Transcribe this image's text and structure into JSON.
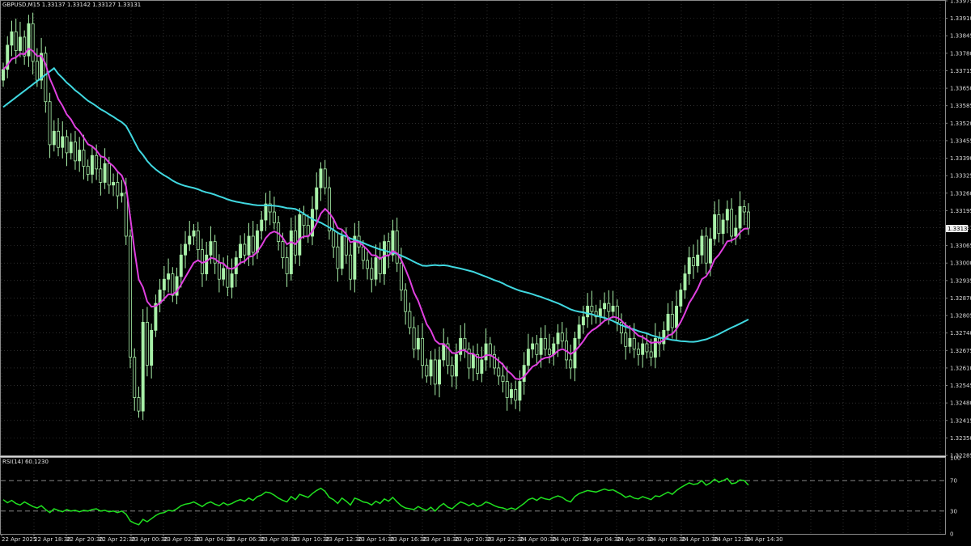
{
  "header": {
    "symbol_info": "GBPUSD,M15  1.33137 1.33142 1.33127 1.33131",
    "rsi_label": "RSI(14) 60.1230"
  },
  "price_tag": "1.33131",
  "colors": {
    "background": "#000000",
    "grid": "#4a4a4a",
    "candle_up": "#a8f0a8",
    "candle_down": "#000000",
    "candle_outline": "#a8f0a8",
    "ma_fast": "#e040e0",
    "ma_slow": "#40d8e0",
    "rsi_line": "#20e020",
    "axis_text": "#dcdcdc",
    "rsi_level_line": "#9a9a9a"
  },
  "chart_data": [
    {
      "type": "candlestick",
      "title": "GBPUSD,M15",
      "ohlc_readout": {
        "open": 1.33137,
        "high": 1.33142,
        "low": 1.33127,
        "close": 1.33131
      },
      "y_ticks": [
        "1.33975",
        "1.33910",
        "1.33845",
        "1.33780",
        "1.33715",
        "1.33650",
        "1.33585",
        "1.33520",
        "1.33455",
        "1.33390",
        "1.33325",
        "1.33260",
        "1.33195",
        "1.33131",
        "1.33065",
        "1.33000",
        "1.32935",
        "1.32870",
        "1.32805",
        "1.32740",
        "1.32675",
        "1.32610",
        "1.32545",
        "1.32480",
        "1.32415",
        "1.32350",
        "1.32285"
      ],
      "ylim": [
        1.32285,
        1.33975
      ],
      "x_ticks": [
        "22 Apr 2025",
        "22 Apr 18:30",
        "22 Apr 20:30",
        "22 Apr 22:30",
        "23 Apr 00:30",
        "23 Apr 02:30",
        "23 Apr 04:30",
        "23 Apr 06:30",
        "23 Apr 08:30",
        "23 Apr 10:30",
        "23 Apr 12:30",
        "23 Apr 14:30",
        "23 Apr 16:30",
        "23 Apr 18:30",
        "23 Apr 20:30",
        "23 Apr 22:30",
        "24 Apr 00:30",
        "24 Apr 02:30",
        "24 Apr 04:30",
        "24 Apr 06:30",
        "24 Apr 08:30",
        "24 Apr 10:30",
        "24 Apr 12:30",
        "24 Apr 14:30"
      ],
      "close_series": [
        1.3372,
        1.3381,
        1.3386,
        1.3379,
        1.3384,
        1.3377,
        1.3389,
        1.3375,
        1.3368,
        1.3378,
        1.336,
        1.3344,
        1.3349,
        1.3343,
        1.3347,
        1.3341,
        1.3345,
        1.3338,
        1.3342,
        1.3336,
        1.3333,
        1.334,
        1.3335,
        1.333,
        1.3337,
        1.3329,
        1.333,
        1.3325,
        1.3326,
        1.331,
        1.3265,
        1.325,
        1.3245,
        1.3278,
        1.3262,
        1.3275,
        1.3285,
        1.329,
        1.3294,
        1.3296,
        1.3288,
        1.3295,
        1.3303,
        1.3307,
        1.331,
        1.3312,
        1.3305,
        1.3296,
        1.3303,
        1.3308,
        1.33,
        1.3294,
        1.3298,
        1.3291,
        1.3296,
        1.3302,
        1.3307,
        1.3303,
        1.331,
        1.3304,
        1.3312,
        1.3316,
        1.3322,
        1.3319,
        1.3315,
        1.3308,
        1.3302,
        1.3296,
        1.3312,
        1.3303,
        1.3318,
        1.3314,
        1.331,
        1.332,
        1.3328,
        1.3335,
        1.3328,
        1.3312,
        1.3306,
        1.3298,
        1.331,
        1.3303,
        1.3294,
        1.331,
        1.3306,
        1.3301,
        1.3298,
        1.3294,
        1.3302,
        1.3296,
        1.3308,
        1.3303,
        1.3312,
        1.33,
        1.329,
        1.3282,
        1.3276,
        1.3268,
        1.3272,
        1.3262,
        1.3258,
        1.3264,
        1.3255,
        1.3264,
        1.327,
        1.3262,
        1.3258,
        1.3266,
        1.3272,
        1.3268,
        1.3261,
        1.3266,
        1.3259,
        1.3264,
        1.327,
        1.3266,
        1.3261,
        1.3258,
        1.3256,
        1.325,
        1.3253,
        1.3249,
        1.3256,
        1.3262,
        1.3268,
        1.327,
        1.3266,
        1.3272,
        1.3268,
        1.3266,
        1.327,
        1.3274,
        1.3271,
        1.3264,
        1.3261,
        1.3272,
        1.3277,
        1.328,
        1.3284,
        1.3282,
        1.328,
        1.3283,
        1.3285,
        1.3282,
        1.3284,
        1.3278,
        1.3274,
        1.3269,
        1.3272,
        1.3268,
        1.3266,
        1.327,
        1.3267,
        1.3265,
        1.3272,
        1.327,
        1.3275,
        1.3281,
        1.3276,
        1.3284,
        1.329,
        1.3296,
        1.3302,
        1.3299,
        1.3303,
        1.331,
        1.33,
        1.3309,
        1.3318,
        1.3311,
        1.3316,
        1.332,
        1.331,
        1.3313,
        1.3321,
        1.3319,
        1.3313
      ],
      "indicators": [
        {
          "name": "MA fast",
          "color": "#e040e0"
        },
        {
          "name": "MA slow",
          "color": "#40d8e0"
        }
      ]
    },
    {
      "type": "line",
      "title": "RSI(14) 60.1230",
      "y_ticks": [
        "100",
        "70",
        "30",
        "0"
      ],
      "ylim": [
        0,
        100
      ],
      "levels": [
        70,
        30
      ],
      "series": [
        {
          "values": [
            45,
            41,
            44,
            40,
            38,
            42,
            39,
            36,
            34,
            37,
            32,
            28,
            33,
            31,
            29,
            32,
            30,
            31,
            29,
            31,
            30,
            32,
            33,
            30,
            31,
            29,
            30,
            28,
            30,
            26,
            17,
            14,
            12,
            19,
            16,
            20,
            24,
            27,
            28,
            31,
            30,
            33,
            37,
            39,
            40,
            42,
            39,
            36,
            40,
            42,
            39,
            37,
            41,
            38,
            40,
            43,
            45,
            43,
            47,
            44,
            49,
            51,
            55,
            54,
            51,
            47,
            44,
            42,
            49,
            45,
            52,
            50,
            48,
            53,
            57,
            60,
            56,
            48,
            45,
            40,
            47,
            43,
            38,
            47,
            45,
            42,
            41,
            38,
            43,
            40,
            46,
            43,
            48,
            42,
            37,
            34,
            33,
            32,
            36,
            33,
            31,
            35,
            30,
            36,
            40,
            35,
            33,
            38,
            42,
            40,
            37,
            40,
            36,
            38,
            42,
            40,
            37,
            35,
            34,
            32,
            34,
            32,
            36,
            40,
            45,
            47,
            44,
            48,
            46,
            45,
            48,
            50,
            48,
            44,
            42,
            49,
            53,
            55,
            57,
            56,
            55,
            57,
            59,
            57,
            58,
            55,
            52,
            48,
            50,
            47,
            46,
            49,
            47,
            45,
            50,
            49,
            52,
            55,
            52,
            57,
            61,
            64,
            67,
            65,
            66,
            70,
            64,
            67,
            72,
            68,
            70,
            73,
            66,
            67,
            71,
            70,
            64
          ]
        }
      ]
    }
  ]
}
